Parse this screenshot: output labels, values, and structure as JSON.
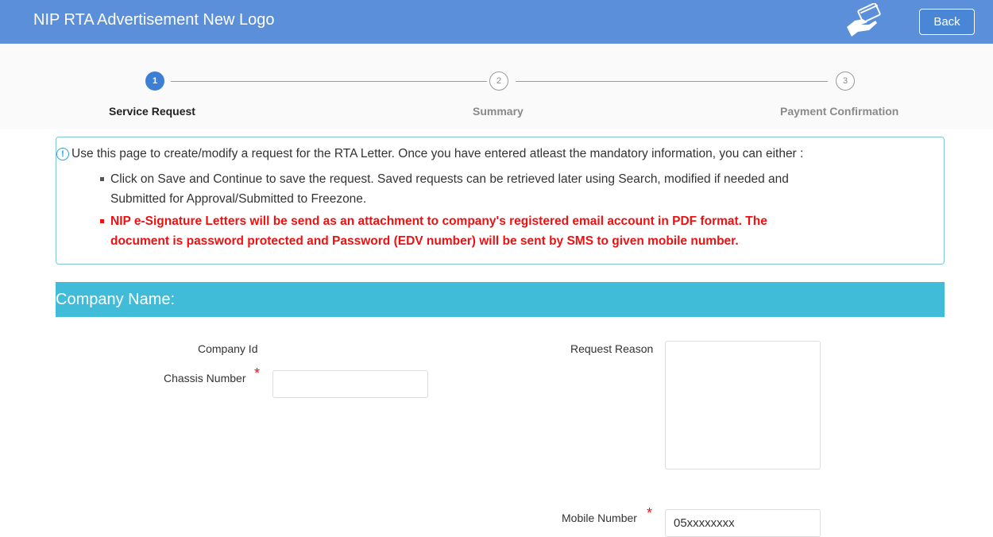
{
  "header": {
    "title": "NIP RTA Advertisement New Logo",
    "back_label": "Back",
    "brand_color": "#5b8fd9",
    "icon": "hand-card-icon"
  },
  "wizard": {
    "steps": [
      {
        "number": "1",
        "label": "Service Request",
        "active": true
      },
      {
        "number": "2",
        "label": "Summary",
        "active": false
      },
      {
        "number": "3",
        "label": "Payment Confirmation",
        "active": false
      }
    ]
  },
  "info": {
    "intro": "Use this page to create/modify a request for the RTA Letter. Once you have entered atleast the mandatory information, you can either :",
    "bullet1_line1": "Click on Save and Continue to save the request. Saved requests can be retrieved later using Search, modified if needed and",
    "bullet1_line2": "Submitted for Approval/Submitted to Freezone.",
    "bullet2_line1": "NIP e-Signature Letters will be send as an attachment to company's registered email account in PDF format. The",
    "bullet2_line2": "document is password protected and Password (EDV number) will be sent by SMS to given mobile number.",
    "warning_color": "#ee1111"
  },
  "company": {
    "bar_label": "Company Name:",
    "bar_color": "#40bcd9"
  },
  "form": {
    "company_id_label": "Company Id",
    "chassis_label": "Chassis Number",
    "chassis_value": "",
    "request_reason_label": "Request Reason",
    "request_reason_value": "",
    "mobile_label": "Mobile Number",
    "mobile_placeholder": "05xxxxxxxx",
    "required_mark": "*"
  }
}
